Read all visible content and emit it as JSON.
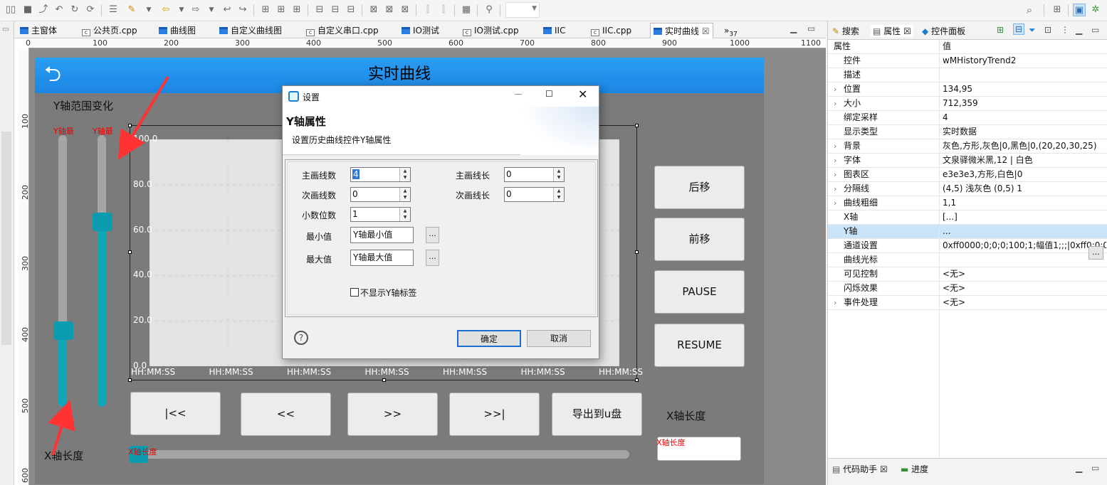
{
  "toolbar": {
    "combo_value": ""
  },
  "tabs": [
    "主窗体",
    "公共页.cpp",
    "曲线图",
    "自定义曲线图",
    "自定义串口.cpp",
    "IO测试",
    "IO测试.cpp",
    "IIC",
    "IIC.cpp",
    "实时曲线"
  ],
  "tab_overflow": "»",
  "tab_overflow_count": "37",
  "ruler": {
    "h": [
      "0",
      "100",
      "200",
      "300",
      "400",
      "500",
      "600",
      "700",
      "800",
      "900",
      "1000",
      "1100"
    ],
    "v": [
      "100",
      "200",
      "300",
      "400",
      "500",
      "600"
    ]
  },
  "screen": {
    "title": "实时曲线",
    "y_range_label": "Y轴范围变化",
    "slider1_label": "Y轴最",
    "slider2_label": "Y轴最",
    "slider1_value": 0.28,
    "slider2_value": 0.68,
    "x_length_label_left": "X轴长度",
    "x_slider_label": "X轴长度",
    "x_length_label_right": "X轴长度",
    "x_input_label": "X轴长度",
    "buttons": {
      "back": "后移",
      "forward": "前移",
      "pause": "PAUSE",
      "resume": "RESUME",
      "first": "|<<",
      "prev": "<<",
      "next": ">>",
      "last": ">>|",
      "export": "导出到u盘"
    }
  },
  "chart_data": {
    "type": "line",
    "y_ticks": [
      "0.0",
      "20.0",
      "40.0",
      "60.0",
      "80.0",
      "100.0"
    ],
    "x_ticks": [
      "HH:MM:SS",
      "HH:MM:SS",
      "HH:MM:SS",
      "HH:MM:SS",
      "HH:MM:SS",
      "HH:MM:SS",
      "HH:MM:SS"
    ],
    "ylim": [
      0,
      100
    ],
    "series": [],
    "grid": true
  },
  "dialog": {
    "window_title": "设置",
    "heading": "Y轴属性",
    "subheading": "设置历史曲线控件Y轴属性",
    "fields": {
      "major_count_label": "主画线数",
      "major_count": "4",
      "major_len_label": "主画线长",
      "major_len": "0",
      "minor_count_label": "次画线数",
      "minor_count": "0",
      "minor_len_label": "次画线长",
      "minor_len": "0",
      "decimals_label": "小数位数",
      "decimals": "1",
      "min_label": "最小值",
      "min_value": "Y轴最小值",
      "max_label": "最大值",
      "max_value": "Y轴最大值",
      "browse": "...",
      "hide_label": "不显示Y轴标签"
    },
    "ok": "确定",
    "cancel": "取消",
    "help": "?"
  },
  "right_panel": {
    "tabs": [
      "搜索",
      "属性",
      "控件面板"
    ],
    "col_headers": [
      "属性",
      "值"
    ],
    "rows": [
      {
        "k": "控件",
        "v": "wMHistoryTrend2",
        "exp": false
      },
      {
        "k": "描述",
        "v": "",
        "exp": false
      },
      {
        "k": "位置",
        "v": "134,95",
        "exp": true
      },
      {
        "k": "大小",
        "v": "712,359",
        "exp": true
      },
      {
        "k": "绑定采样",
        "v": "4",
        "exp": false
      },
      {
        "k": "显示类型",
        "v": "实时数据",
        "exp": false
      },
      {
        "k": "背景",
        "v": "灰色,方形,灰色|0,黑色|0,(20,20,30,25)",
        "exp": true
      },
      {
        "k": "字体",
        "v": "文泉驿微米黑,12 | 白色",
        "exp": true
      },
      {
        "k": "图表区",
        "v": "e3e3e3,方形,白色|0",
        "exp": true
      },
      {
        "k": "分隔线",
        "v": "(4,5) 浅灰色 (0,5) 1",
        "exp": true
      },
      {
        "k": "曲线粗细",
        "v": "1,1",
        "exp": true
      },
      {
        "k": "X轴",
        "v": "[...]",
        "exp": false
      },
      {
        "k": "Y轴",
        "v": "...",
        "exp": false
      },
      {
        "k": "通道设置",
        "v": "0xff0000;0;0;0;100;1;幅值1;;;|0xff0;0;0;...",
        "exp": false
      },
      {
        "k": "曲线光标",
        "v": "",
        "exp": false
      },
      {
        "k": "可见控制",
        "v": "<无>",
        "exp": false
      },
      {
        "k": "闪烁效果",
        "v": "<无>",
        "exp": false
      },
      {
        "k": "事件处理",
        "v": "<无>",
        "exp": true
      }
    ],
    "browse": "...",
    "bottom_tabs": [
      "代码助手",
      "进度"
    ]
  }
}
